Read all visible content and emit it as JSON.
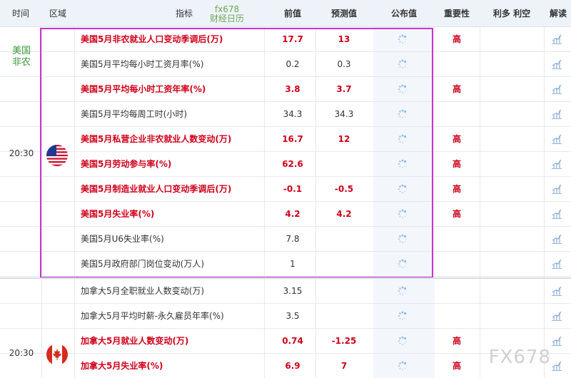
{
  "header": {
    "time": "时间",
    "region": "区域",
    "indicator": "指标",
    "brand_line1": "fx678",
    "brand_line2": "财经日历",
    "previous": "前值",
    "forecast": "预测值",
    "published": "公布值",
    "importance": "重要性",
    "effect": "利多 利空",
    "interpret": "解读"
  },
  "groups": [
    {
      "label_line1": "美国",
      "label_line2": "非农",
      "time": "20:30",
      "flag": "us-flag-icon",
      "rows": [
        {
          "name": "美国5月非农就业人口变动季调后(万)",
          "previous": "17.7",
          "forecast": "13",
          "importance": "高",
          "highlight": true
        },
        {
          "name": "美国5月平均每小时工资月率(%)",
          "previous": "0.2",
          "forecast": "0.3",
          "importance": "",
          "highlight": false
        },
        {
          "name": "美国5月平均每小时工资年率(%)",
          "previous": "3.8",
          "forecast": "3.7",
          "importance": "高",
          "highlight": true
        },
        {
          "name": "美国5月平均每周工时(小时)",
          "previous": "34.3",
          "forecast": "34.3",
          "importance": "",
          "highlight": false
        },
        {
          "name": "美国5月私营企业非农就业人数变动(万)",
          "previous": "16.7",
          "forecast": "12",
          "importance": "高",
          "highlight": true
        },
        {
          "name": "美国5月劳动参与率(%)",
          "previous": "62.6",
          "forecast": "",
          "importance": "高",
          "highlight": true
        },
        {
          "name": "美国5月制造业就业人口变动季调后(万)",
          "previous": "-0.1",
          "forecast": "-0.5",
          "importance": "高",
          "highlight": true
        },
        {
          "name": "美国5月失业率(%)",
          "previous": "4.2",
          "forecast": "4.2",
          "importance": "高",
          "highlight": true
        },
        {
          "name": "美国5月U6失业率(%)",
          "previous": "7.8",
          "forecast": "",
          "importance": "",
          "highlight": false
        },
        {
          "name": "美国5月政府部门岗位变动(万人)",
          "previous": "1",
          "forecast": "",
          "importance": "",
          "highlight": false
        }
      ]
    },
    {
      "time": "20:30",
      "flag": "canada-flag-icon",
      "rows": [
        {
          "name": "加拿大5月全职就业人数变动(万)",
          "previous": "3.15",
          "forecast": "",
          "importance": "",
          "highlight": false
        },
        {
          "name": "加拿大5月平均时薪-永久雇员年率(%)",
          "previous": "3.5",
          "forecast": "",
          "importance": "",
          "highlight": false
        },
        {
          "name": "加拿大5月就业人数变动(万)",
          "previous": "0.74",
          "forecast": "-1.25",
          "importance": "高",
          "highlight": true
        },
        {
          "name": "加拿大5月失业率(%)",
          "previous": "6.9",
          "forecast": "7",
          "importance": "高",
          "highlight": true
        }
      ]
    }
  ],
  "watermark": "FX678",
  "colors": {
    "highlight_text": "#d0021b",
    "nfp_label": "#3a9a3a",
    "brand": "#6aa84f",
    "box_border": "#cc33cc",
    "header_bg": "#eef3fa"
  }
}
